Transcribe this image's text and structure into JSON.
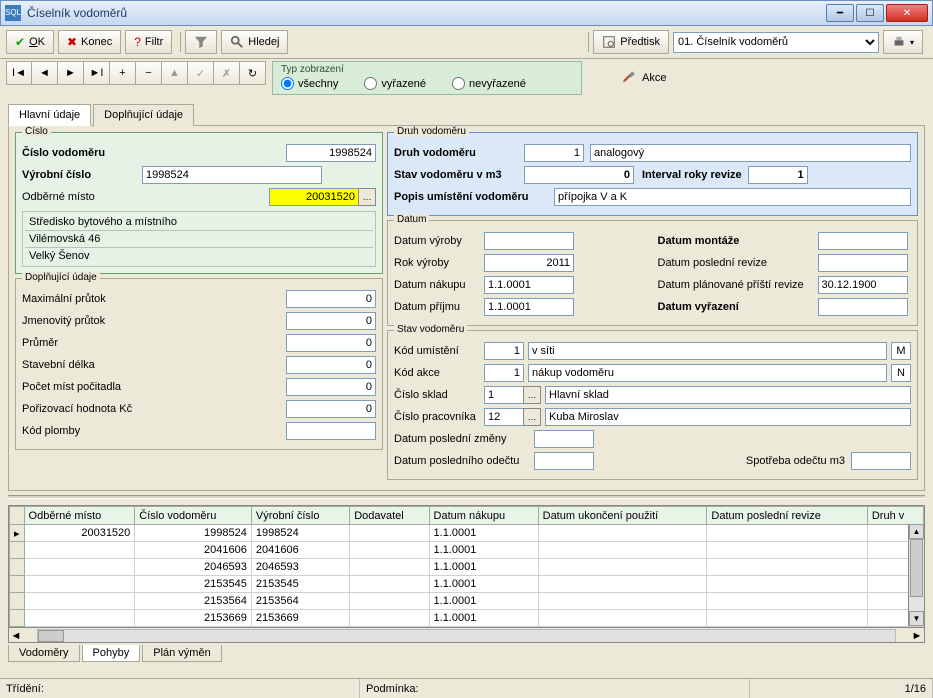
{
  "window": {
    "title": "Číselník vodoměrů"
  },
  "toolbar": {
    "ok": "OK",
    "konec": "Konec",
    "filtr": "Filtr",
    "hledej": "Hledej",
    "predtisk": "Předtisk",
    "predtisk_select": "01. Číselník vodoměrů"
  },
  "nav": {
    "akce": "Akce"
  },
  "typzobr": {
    "legend": "Typ zobrazení",
    "vsechny": "všechny",
    "vyrazene": "vyřazené",
    "nevyrazene": "nevyřazené"
  },
  "tabs": {
    "hlavni": "Hlavní údaje",
    "doplnujici": "Doplňující údaje"
  },
  "cislo": {
    "legend": "Číslo",
    "cislo_vodomeru_lbl": "Číslo vodoměru",
    "cislo_vodomeru": "1998524",
    "vyrobni_cislo_lbl": "Výrobní číslo",
    "vyrobni_cislo": "1998524",
    "odberne_misto_lbl": "Odběrné místo",
    "odberne_misto": "20031520",
    "addr1": "Středisko bytového a místního",
    "addr2": "Vilémovská 46",
    "addr3": "Velký Šenov"
  },
  "druh": {
    "legend": "Druh vodoměru",
    "druh_lbl": "Druh vodoměru",
    "druh_kod": "1",
    "druh_text": "analogový",
    "stav_lbl": "Stav vodoměru v m3",
    "stav": "0",
    "interval_lbl": "Interval roky revize",
    "interval": "1",
    "popis_lbl": "Popis umístění vodoměru",
    "popis": "přípojka V a K"
  },
  "datum": {
    "legend": "Datum",
    "vyroby_lbl": "Datum výroby",
    "vyroby": "",
    "rok_lbl": "Rok výroby",
    "rok": "2011",
    "nakupu_lbl": "Datum nákupu",
    "nakupu": "1.1.0001",
    "prijmu_lbl": "Datum příjmu",
    "prijmu": "1.1.0001",
    "montaze_lbl": "Datum montáže",
    "montaze": "",
    "pos_revize_lbl": "Datum poslední revize",
    "pos_revize": "",
    "plan_revize_lbl": "Datum plánované příští revize",
    "plan_revize": "30.12.1900",
    "vyrazeni_lbl": "Datum vyřazení",
    "vyrazeni": ""
  },
  "dopln": {
    "legend": "Doplňující údaje",
    "max_lbl": "Maximální průtok",
    "max": "0",
    "jmen_lbl": "Jmenovitý průtok",
    "jmen": "0",
    "prumer_lbl": "Průměr",
    "prumer": "0",
    "stav_delka_lbl": "Stavební délka",
    "stav_delka": "0",
    "pocet_mist_lbl": "Počet míst počitadla",
    "pocet_mist": "0",
    "poriz_lbl": "Pořizovací hodnota Kč",
    "poriz": "0",
    "plomby_lbl": "Kód plomby",
    "plomby": ""
  },
  "stavvod": {
    "legend": "Stav vodoměru",
    "kod_umisteni_lbl": "Kód umístění",
    "kod_umisteni": "1",
    "kod_umisteni_text": "v síti",
    "kod_umisteni_sfx": "M",
    "kod_akce_lbl": "Kód akce",
    "kod_akce": "1",
    "kod_akce_text": "nákup vodoměru",
    "kod_akce_sfx": "N",
    "cislo_sklad_lbl": "Číslo sklad",
    "cislo_sklad": "1",
    "cislo_sklad_text": "Hlavní sklad",
    "cislo_prac_lbl": "Číslo pracovníka",
    "cislo_prac": "12",
    "cislo_prac_text": "Kuba Miroslav",
    "datum_zmeny_lbl": "Datum poslední změny",
    "datum_zmeny": "",
    "datum_odectu_lbl": "Datum posledního odečtu",
    "datum_odectu": "",
    "spotreba_lbl": "Spotřeba  odečtu m3",
    "spotreba": ""
  },
  "grid": {
    "cols": [
      "Odběrné místo",
      "Číslo vodoměru",
      "Výrobní číslo",
      "Dodavatel",
      "Datum nákupu",
      "Datum ukončení použití",
      "Datum poslední revize",
      "Druh v"
    ],
    "rows": [
      {
        "om": "20031520",
        "cv": "1998524",
        "vc": "1998524",
        "dod": "",
        "dn": "1.1.0001",
        "du": "",
        "dpr": "",
        "dv": ""
      },
      {
        "om": "",
        "cv": "2041606",
        "vc": "2041606",
        "dod": "",
        "dn": "1.1.0001",
        "du": "",
        "dpr": "",
        "dv": ""
      },
      {
        "om": "",
        "cv": "2046593",
        "vc": "2046593",
        "dod": "",
        "dn": "1.1.0001",
        "du": "",
        "dpr": "",
        "dv": ""
      },
      {
        "om": "",
        "cv": "2153545",
        "vc": "2153545",
        "dod": "",
        "dn": "1.1.0001",
        "du": "",
        "dpr": "",
        "dv": ""
      },
      {
        "om": "",
        "cv": "2153564",
        "vc": "2153564",
        "dod": "",
        "dn": "1.1.0001",
        "du": "",
        "dpr": "",
        "dv": ""
      },
      {
        "om": "",
        "cv": "2153669",
        "vc": "2153669",
        "dod": "",
        "dn": "1.1.0001",
        "du": "",
        "dpr": "",
        "dv": ""
      }
    ]
  },
  "bottomtabs": {
    "vodomery": "Vodoměry",
    "pohyby": "Pohyby",
    "plan": "Plán výměn"
  },
  "status": {
    "trideni": "Třídění:",
    "podminka": "Podmínka:",
    "pos": "1/16"
  }
}
